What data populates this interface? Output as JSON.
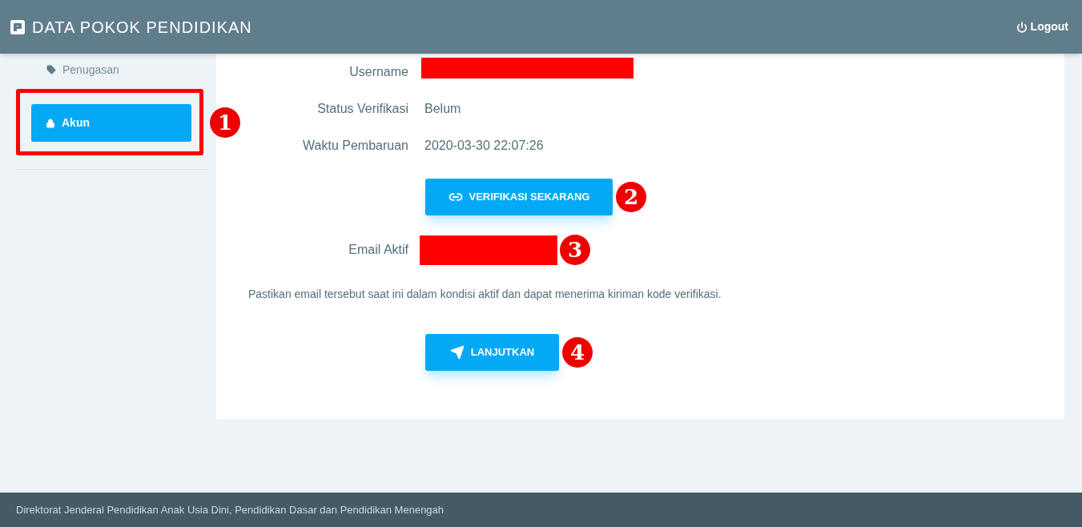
{
  "header": {
    "title": "DATA POKOK PENDIDIKAN",
    "logout": "Logout"
  },
  "sidebar": {
    "items": [
      {
        "label": "Penugasan",
        "kind": "link",
        "selected": false
      },
      {
        "label": "Akun",
        "kind": "button",
        "selected": true,
        "callout": "1"
      }
    ]
  },
  "form": {
    "rows": [
      {
        "label": "Username",
        "kind": "redacted"
      },
      {
        "label": "Status Verifikasi",
        "kind": "text",
        "value": "Belum"
      },
      {
        "label": "Waktu Pembaruan",
        "kind": "text",
        "value": "2020-03-30 22:07:26"
      }
    ],
    "verify_button": {
      "label": "VERIFIKASI SEKARANG",
      "callout": "2"
    },
    "email": {
      "label": "Email Aktif",
      "callout": "3"
    },
    "note": "Pastikan email tersebut saat ini dalam kondisi aktif dan dapat menerima kiriman kode verifikasi.",
    "continue_button": {
      "label": "LANJUTKAN",
      "callout": "4"
    }
  },
  "footer": "Direktorat Jenderal Pendidikan Anak Usia Dini, Pendidikan Dasar dan Pendidikan Menengah"
}
